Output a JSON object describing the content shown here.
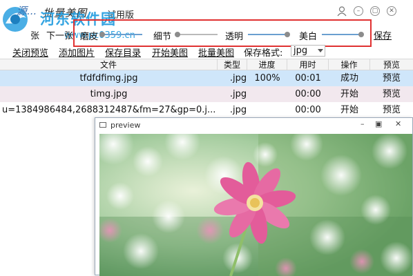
{
  "app": {
    "title_partial": "源...",
    "title": "批量美图",
    "edition": "试用版"
  },
  "watermark": {
    "text": "河东软件园",
    "url": "www.pc0359.cn"
  },
  "toolbar": {
    "prev_partial": "张",
    "next": "下一张",
    "sliders": [
      {
        "label": "磨皮",
        "level": 0.0
      },
      {
        "label": "细节",
        "level": 0.0
      },
      {
        "label": "透明",
        "level": 1.0
      },
      {
        "label": "美白",
        "level": 1.0
      }
    ],
    "save": "保存"
  },
  "toolbar2": {
    "close_preview": "关闭预览",
    "add_image": "添加图片",
    "save_dir": "保存目录",
    "start": "开始美图",
    "batch": "批量美图",
    "format_label": "保存格式:",
    "format_value": "jpg"
  },
  "table": {
    "headers": [
      "文件",
      "类型",
      "进度",
      "用时",
      "操作",
      "预览"
    ],
    "rows": [
      {
        "file": "tfdfdfimg.jpg",
        "type": ".jpg",
        "progress": "100%",
        "time": "00:01",
        "action": "成功",
        "preview": "预览"
      },
      {
        "file": "timg.jpg",
        "type": ".jpg",
        "progress": "",
        "time": "00:00",
        "action": "开始",
        "preview": "预览"
      },
      {
        "file": "u=1384986484,2688312487&fm=27&gp=0.j...",
        "type": ".jpg",
        "progress": "",
        "time": "00:00",
        "action": "开始",
        "preview": "预览"
      }
    ]
  },
  "preview": {
    "title": "preview"
  },
  "colors": {
    "selected_row": "#cfe6fa",
    "highlight_border": "#e03030",
    "slider_track": "#6a9fd0",
    "watermark": "#2aa0e0"
  }
}
